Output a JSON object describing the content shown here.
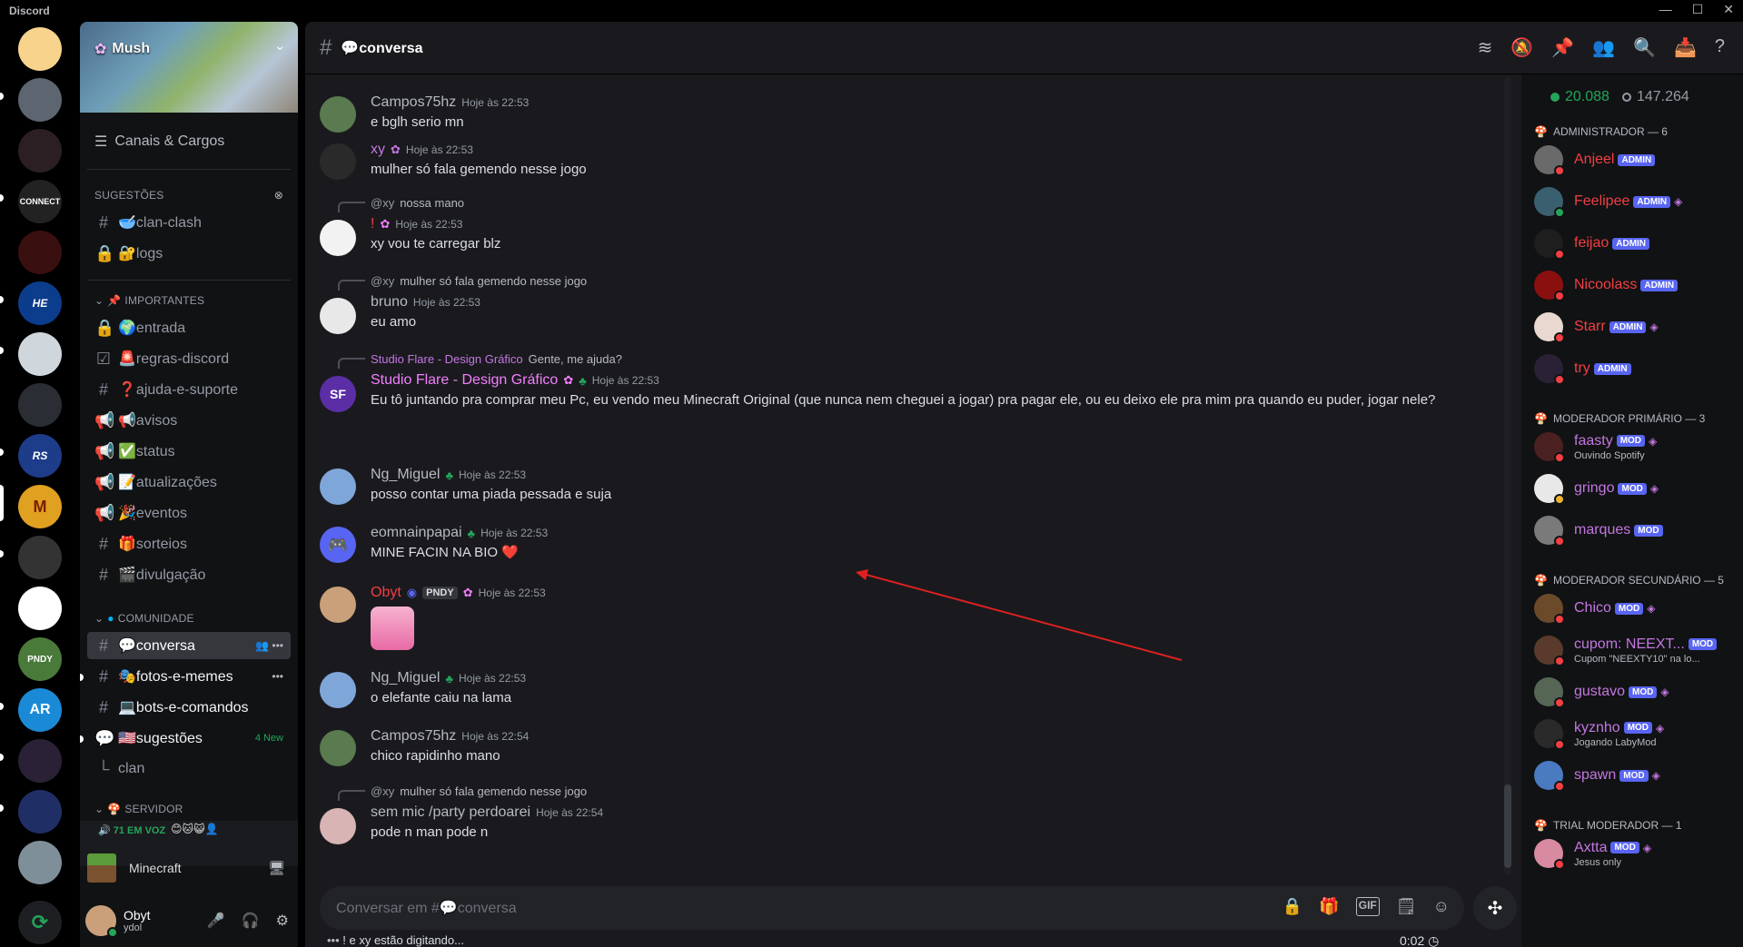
{
  "window": {
    "title": "Discord",
    "controls": [
      "—",
      "☐",
      "✕"
    ]
  },
  "server": {
    "name": "Mush"
  },
  "sidebar": {
    "roles_link": "Canais & Cargos",
    "suggestions_header": "SUGESTÕES",
    "suggestions": [
      {
        "icon": "#",
        "label": "🥣clan-clash"
      },
      {
        "icon": "🔒",
        "label": "🔐logs"
      }
    ],
    "important_header": "IMPORTANTES",
    "important": [
      {
        "icon": "🔒",
        "label": "🌍entrada"
      },
      {
        "icon": "☑",
        "label": "🚨regras-discord"
      },
      {
        "icon": "#",
        "label": "❓ajuda-e-suporte"
      },
      {
        "icon": "📢",
        "label": "📢avisos"
      },
      {
        "icon": "📢",
        "label": "✅status"
      },
      {
        "icon": "📢",
        "label": "📝atualizações"
      },
      {
        "icon": "📢",
        "label": "🎉eventos"
      },
      {
        "icon": "#",
        "label": "🎁sorteios"
      },
      {
        "icon": "#",
        "label": "🎬divulgação"
      }
    ],
    "community_header": "COMUNIDADE",
    "community": [
      {
        "icon": "#",
        "label": "💬conversa"
      },
      {
        "icon": "#",
        "label": "🎭fotos-e-memes"
      },
      {
        "icon": "#",
        "label": "💻bots-e-comandos"
      },
      {
        "icon": "💬",
        "label": "🇺🇸sugestões",
        "badge": "4 New"
      },
      {
        "icon": "└",
        "label": "clan"
      }
    ],
    "server_header": "SERVIDOR",
    "voice_status": "🔊 71 EM VOZ",
    "minecraft": "Minecraft",
    "user": {
      "name": "Obyt",
      "tag": "ydol"
    }
  },
  "channel": {
    "name": "💬conversa"
  },
  "messages": [
    {
      "user": "Campos75hz",
      "time": "Hoje às 22:53",
      "text": "e bglh serio mn"
    },
    {
      "user": "xy",
      "time": "Hoje às 22:53",
      "text": "mulher só fala gemendo nesse jogo"
    },
    {
      "reply_to": "@xy",
      "reply_text": "nossa mano",
      "user": "!",
      "time": "Hoje às 22:53",
      "text": "xy vou te carregar blz"
    },
    {
      "reply_to": "@xy",
      "reply_text": "mulher só fala gemendo nesse jogo",
      "user": "bruno",
      "time": "Hoje às 22:53",
      "text": "eu amo"
    },
    {
      "reply_to": "Studio Flare - Design Gráfico",
      "reply_text": "Gente, me ajuda?",
      "user": "Studio Flare - Design Gráfico",
      "time": "Hoje às 22:53",
      "text": "Eu tô juntando pra comprar meu Pc, eu vendo meu Minecraft Original (que nunca nem cheguei a jogar) pra pagar ele, ou eu deixo ele pra mim pra quando eu puder, jogar nele?"
    },
    {
      "user": "Ng_Miguel",
      "time": "Hoje às 22:53",
      "text": "posso contar uma piada pessada e suja"
    },
    {
      "user": "eomnainpapai",
      "time": "Hoje às 22:53",
      "text": "MINE FACIN NA BIO ❤️"
    },
    {
      "user": "Obyt",
      "badge": "PNDY",
      "time": "Hoje às 22:53",
      "text": ""
    },
    {
      "user": "Ng_Miguel",
      "time": "Hoje às 22:53",
      "text": "o elefante caiu na lama"
    },
    {
      "user": "Campos75hz",
      "time": "Hoje às 22:54",
      "text": "chico rapidinho mano"
    },
    {
      "reply_to": "@xy",
      "reply_text": "mulher só fala gemendo nesse jogo",
      "user": "sem mic /party perdoarei",
      "time": "Hoje às 22:54",
      "text": "pode n man pode n"
    }
  ],
  "composer": {
    "placeholder": "Conversar em #💬conversa"
  },
  "typing": "! e xy estão digitando...",
  "clock": "0:02",
  "members": {
    "online": "20.088",
    "total": "147.264",
    "groups": [
      {
        "title": "ADMINISTRADOR — 6",
        "color": "#f23f43",
        "items": [
          {
            "name": "Anjeel",
            "tag": "ADMIN"
          },
          {
            "name": "Feelipee",
            "tag": "ADMIN",
            "online": true
          },
          {
            "name": "feijao",
            "tag": "ADMIN"
          },
          {
            "name": "Nicoolass",
            "tag": "ADMIN"
          },
          {
            "name": "Starr",
            "tag": "ADMIN"
          },
          {
            "name": "try",
            "tag": "ADMIN"
          }
        ]
      },
      {
        "title": "MODERADOR PRIMÁRIO — 3",
        "color": "#c377e0",
        "items": [
          {
            "name": "faasty",
            "tag": "MOD",
            "activity": "Ouvindo Spotify"
          },
          {
            "name": "gringo",
            "tag": "MOD"
          },
          {
            "name": "marques",
            "tag": "MOD"
          }
        ]
      },
      {
        "title": "MODERADOR SECUNDÁRIO — 5",
        "color": "#c377e0",
        "items": [
          {
            "name": "Chico",
            "tag": "MOD"
          },
          {
            "name": "cupom: NEEXT...",
            "tag": "MOD",
            "activity": "Cupom \"NEEXTY10\" na lo..."
          },
          {
            "name": "gustavo",
            "tag": "MOD"
          },
          {
            "name": "kyznho",
            "tag": "MOD",
            "activity": "Jogando LabyMod"
          },
          {
            "name": "spawn",
            "tag": "MOD"
          }
        ]
      },
      {
        "title": "TRIAL MODERADOR — 1",
        "color": "#c377e0",
        "items": [
          {
            "name": "Axtta",
            "tag": "MOD",
            "activity": "Jesus only"
          }
        ]
      }
    ]
  },
  "rail_servers": [
    "",
    "",
    "",
    "CONNECT",
    "",
    "HE",
    "",
    "",
    "RS",
    "M",
    "",
    "",
    "PNDY",
    "AR",
    "",
    "",
    "",
    "⟳"
  ]
}
